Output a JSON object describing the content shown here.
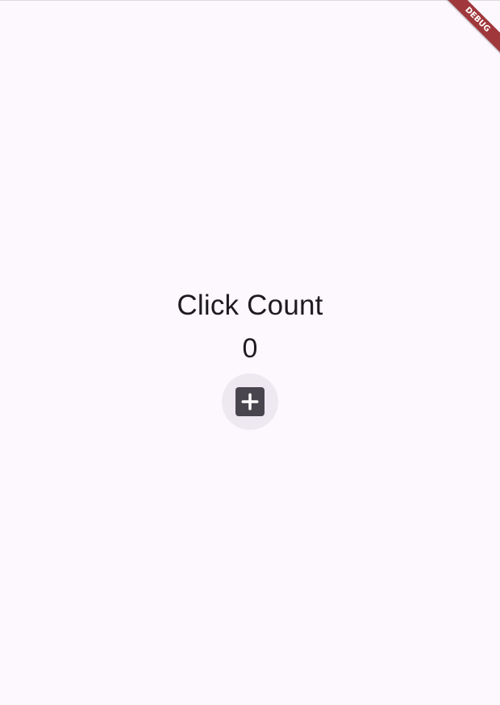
{
  "app": {
    "title_label": "Click Count",
    "count_value": "0",
    "add_button_icon": "add-box-icon",
    "debug_banner_label": "DEBUG"
  },
  "colors": {
    "background": "#fdf7fe",
    "text": "#1d1b20",
    "icon_button_background": "#eee8f1",
    "icon_fill": "#49454f",
    "debug_banner": "#a0373b"
  }
}
